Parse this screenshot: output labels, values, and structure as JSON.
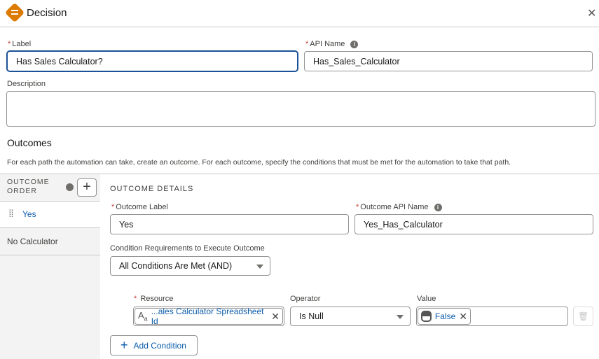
{
  "header": {
    "title": "Decision",
    "close_icon": "close-icon"
  },
  "label": {
    "label": "Label",
    "value": "Has Sales Calculator?"
  },
  "api_name": {
    "label": "API Name",
    "value": "Has_Sales_Calculator"
  },
  "description": {
    "label": "Description",
    "value": ""
  },
  "outcomes": {
    "heading": "Outcomes",
    "help": "For each path the automation can take, create an outcome. For each outcome, specify the conditions that must be met for the automation to take that path."
  },
  "outcome_order": {
    "title_line1": "OUTCOME",
    "title_line2": "ORDER",
    "items": [
      {
        "label": "Yes"
      },
      {
        "label": "No Calculator"
      }
    ]
  },
  "details": {
    "title": "OUTCOME DETAILS",
    "outcome_label": "Outcome Label",
    "outcome_label_value": "Yes",
    "outcome_api_label": "Outcome API Name",
    "outcome_api_value": "Yes_Has_Calculator",
    "cond_req_label": "Condition Requirements to Execute Outcome",
    "cond_req_value": "All Conditions Are Met (AND)",
    "condition": {
      "resource_label": "Resource",
      "resource_value": "...ales Calculator Spreadsheet Id",
      "operator_label": "Operator",
      "operator_value": "Is Null",
      "value_label": "Value",
      "value_value": "False"
    },
    "add_condition": "Add Condition"
  }
}
